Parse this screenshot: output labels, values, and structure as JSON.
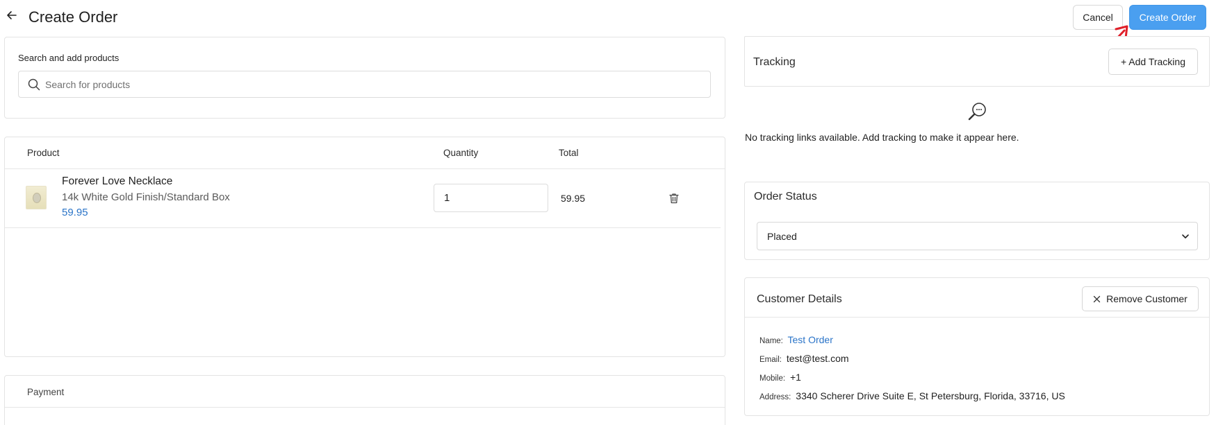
{
  "header": {
    "title": "Create Order",
    "cancel_label": "Cancel",
    "create_label": "Create Order",
    "annotation_color": "#e0202a"
  },
  "search": {
    "label": "Search and add products",
    "placeholder": "Search for products",
    "value": ""
  },
  "products": {
    "columns": {
      "product": "Product",
      "quantity": "Quantity",
      "total": "Total"
    },
    "items": [
      {
        "name": "Forever Love Necklace",
        "variant": "14k White Gold Finish/Standard Box",
        "price": "59.95",
        "quantity": "1",
        "total": "59.95"
      }
    ]
  },
  "payment": {
    "label": "Payment"
  },
  "tracking": {
    "title": "Tracking",
    "add_label": "+ Add Tracking",
    "empty_text": "No tracking links available. Add tracking to make it appear here."
  },
  "order_status": {
    "title": "Order Status",
    "selected": "Placed"
  },
  "customer": {
    "title": "Customer Details",
    "remove_label": "Remove Customer",
    "name_label": "Name:",
    "name": "Test Order",
    "email_label": "Email:",
    "email": "test@test.com",
    "mobile_label": "Mobile:",
    "mobile": "+1",
    "address_label": "Address:",
    "address": "3340 Scherer Drive Suite E, St Petersburg, Florida, 33716, US"
  },
  "colors": {
    "accent": "#4a9ff0",
    "link": "#2a74c8"
  }
}
